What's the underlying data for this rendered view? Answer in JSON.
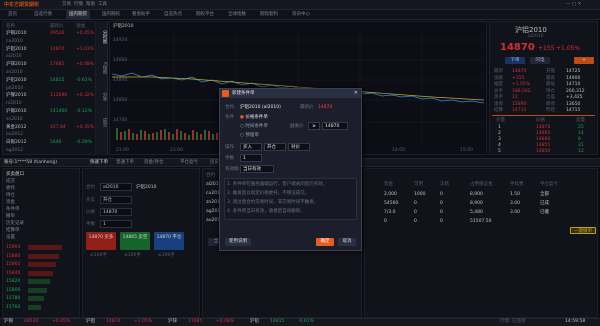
{
  "header": {
    "brand": "中东方期货期权",
    "menu": [
      "交易",
      "行情",
      "帮助",
      "工具"
    ],
    "tabs": [
      "首页",
      "自选行情",
      "国内期货",
      "国内期权",
      "看盘助手",
      "自选热点",
      "期权平台",
      "全球指数",
      "期现套利",
      "资讯中心"
    ],
    "active_tab": 2
  },
  "watchlist": {
    "headers": [
      "名称",
      "最新价",
      "涨幅"
    ],
    "rows": [
      {
        "name": "沪铜2010",
        "price": "49520",
        "chg": "+0.45%",
        "up": true
      },
      {
        "name": "cu2010",
        "price": "",
        "chg": "",
        "up": true
      },
      {
        "name": "沪铝2010",
        "price": "14870",
        "chg": "+1.03%",
        "up": true
      },
      {
        "name": "al2010",
        "price": "",
        "chg": "",
        "up": true
      },
      {
        "name": "沪锌2010",
        "price": "17685",
        "chg": "+0.48%",
        "up": true
      },
      {
        "name": "zn2010",
        "price": "",
        "chg": "",
        "up": true
      },
      {
        "name": "沪铅2010",
        "price": "14815",
        "chg": "-0.61%",
        "up": false
      },
      {
        "name": "pb2010",
        "price": "",
        "chg": "",
        "up": false
      },
      {
        "name": "沪镍2010",
        "price": "112690",
        "chg": "+0.32%",
        "up": true
      },
      {
        "name": "ni2010",
        "price": "",
        "chg": "",
        "up": true
      },
      {
        "name": "沪锡2010",
        "price": "141460",
        "chg": "-0.12%",
        "up": false
      },
      {
        "name": "sn2010",
        "price": "",
        "chg": "",
        "up": false
      },
      {
        "name": "黄金2012",
        "price": "427.84",
        "chg": "+0.35%",
        "up": true
      },
      {
        "name": "au2012",
        "price": "",
        "chg": "",
        "up": true
      },
      {
        "name": "白银2012",
        "price": "5446",
        "chg": "-0.29%",
        "up": false
      },
      {
        "name": "ag2012",
        "price": "",
        "chg": "",
        "up": false
      }
    ]
  },
  "side_tabs": [
    "分时图",
    "K线图",
    "分笔",
    "成交"
  ],
  "chart": {
    "symbol": "沪铝2010",
    "times": [
      "21:00",
      "23:00",
      "01:00",
      "10:15",
      "11:30",
      "14:00",
      "15:00"
    ],
    "prices": [
      "14920",
      "14880",
      "14840",
      "14800",
      "14760"
    ]
  },
  "quote": {
    "name": "沪铝2010",
    "code": "al2010",
    "price": "14870",
    "change": "+155",
    "pct": "+1.05%",
    "stats": [
      [
        "最新",
        "14870",
        "开盘",
        "14725"
      ],
      [
        "涨跌",
        "+155",
        "最高",
        "14900"
      ],
      [
        "幅度",
        "+1.05%",
        "最低",
        "14710"
      ],
      [
        "总手",
        "186,562",
        "持仓",
        "260,312"
      ],
      [
        "现手",
        "12",
        "仓差",
        "+3,425"
      ],
      [
        "涨停",
        "15890",
        "跌停",
        "13650"
      ],
      [
        "结算",
        "14715",
        "昨结",
        "14715"
      ]
    ],
    "buttons": [
      "下单",
      "闪电"
    ],
    "book_headers": [
      "买量",
      "价格",
      "卖量"
    ],
    "book": [
      [
        "1",
        "14870",
        "25"
      ],
      [
        "2",
        "14865",
        "14"
      ],
      [
        "3",
        "14860",
        "8"
      ],
      [
        "4",
        "14855",
        "31"
      ],
      [
        "5",
        "14850",
        "12"
      ]
    ],
    "flow": [
      [
        "14:59:58",
        "14870",
        "3"
      ],
      [
        "14:59:57",
        "14865",
        "2"
      ],
      [
        "14:59:55",
        "14870",
        "5"
      ],
      [
        "14:59:54",
        "14870",
        "1"
      ],
      [
        "14:59:52",
        "14865",
        "4"
      ],
      [
        "14:59:50",
        "14870",
        "2"
      ]
    ]
  },
  "account": {
    "label": "账号:1****58 (tianhong)",
    "tabs": [
      "快速下单",
      "普通下单",
      "资金/持仓",
      "平仓盈亏",
      "历史"
    ],
    "menu_items": [
      "买卖盘口",
      "成交",
      "委托",
      "持仓",
      "资金",
      "条件单",
      "撤单",
      "历史记录",
      "结算单",
      "设置"
    ],
    "levels": [
      "15900",
      "15880",
      "15860",
      "15840",
      "15820",
      "15800",
      "15780",
      "15760"
    ]
  },
  "order_form": {
    "contract_label": "合约",
    "contract_value": "al2010",
    "contract_name": "沪铝2010",
    "direction_label": "买卖",
    "direction_value": "开仓",
    "price_label": "价格",
    "price_value": "14870",
    "qty_label": "手数",
    "qty_value": "1",
    "buy_label": "14870 买多",
    "sell_label": "14865 卖空",
    "close_label": "14870 平仓",
    "sub_labels": [
      "≤100手",
      "≤100手",
      "≤100手"
    ]
  },
  "positions": {
    "headers": [
      "合约",
      "方向",
      "手数",
      "均价",
      "盈亏"
    ],
    "rows": [
      [
        "al2010",
        "买",
        "1",
        "14725",
        "+750"
      ],
      [
        "cu2010",
        "卖",
        "2",
        "49600",
        "+800"
      ],
      [
        "zn2010",
        "买",
        "1",
        "17610",
        "+375"
      ],
      [
        "ag2012",
        "卖",
        "3",
        "5462",
        "+720"
      ],
      [
        "au2012",
        "买",
        "1",
        "426.5",
        "+1340"
      ]
    ],
    "buttons": [
      "全部平仓",
      "反手"
    ]
  },
  "funds": {
    "headers": [
      "资金",
      "可用",
      "冻结",
      "占用保证金",
      "手续费",
      "平仓盈亏"
    ],
    "rows": [
      [
        "2,000",
        "1000",
        "0",
        "8,900",
        "1.50",
        "全部"
      ],
      [
        "54560",
        "0",
        "0",
        "8,900",
        "3.00",
        "已成"
      ],
      [
        "7/3.0",
        "0",
        "0",
        "5,480",
        "3.00",
        "已撤"
      ],
      [
        "0",
        "0",
        "0",
        "51507.50",
        "",
        ""
      ]
    ],
    "action": "一键撤单"
  },
  "dialog": {
    "title": "新建条件单",
    "contract_label": "合约",
    "contract_value": "沪铝2010 (al2010)",
    "price_label": "最新价",
    "price_value": "14870",
    "type_label": "条件",
    "opt1": "价格条件单",
    "opt2": "时间条件单",
    "opt3": "预埋单",
    "op_label": "触发价",
    "op_value": "≥",
    "trigger_value": "14870",
    "action_label": "操作",
    "action_values": [
      "买入",
      "开仓",
      "对价"
    ],
    "qty_label": "手数",
    "qty_value": "1",
    "expire_label": "有效期",
    "expire_value": "当日有效",
    "notes": [
      "1. 条件单在服务器端运行，客户端关闭后仍有效。",
      "2. 触发后以指定价格委托，不保证成交。",
      "3. 请注意合约交易时间，非交易时间不触发。",
      "4. 条件单当日有效，收盘后自动删除。"
    ],
    "help": "使用说明",
    "ok": "确定",
    "cancel": "取消"
  },
  "statusbar": {
    "items": [
      {
        "name": "沪铜",
        "price": "49520",
        "chg": "+0.45%",
        "up": true
      },
      {
        "name": "沪铝",
        "price": "14870",
        "chg": "+1.05%",
        "up": true
      },
      {
        "name": "沪锌",
        "price": "17685",
        "chg": "+0.48%",
        "up": true
      },
      {
        "name": "沪铅",
        "price": "14815",
        "chg": "-0.61%",
        "up": false
      }
    ],
    "time": "14:59:58",
    "server": "行情: 已连接"
  },
  "colors": {
    "up": "#ff3b3b",
    "down": "#22c55e",
    "accent": "#e85d1c"
  }
}
